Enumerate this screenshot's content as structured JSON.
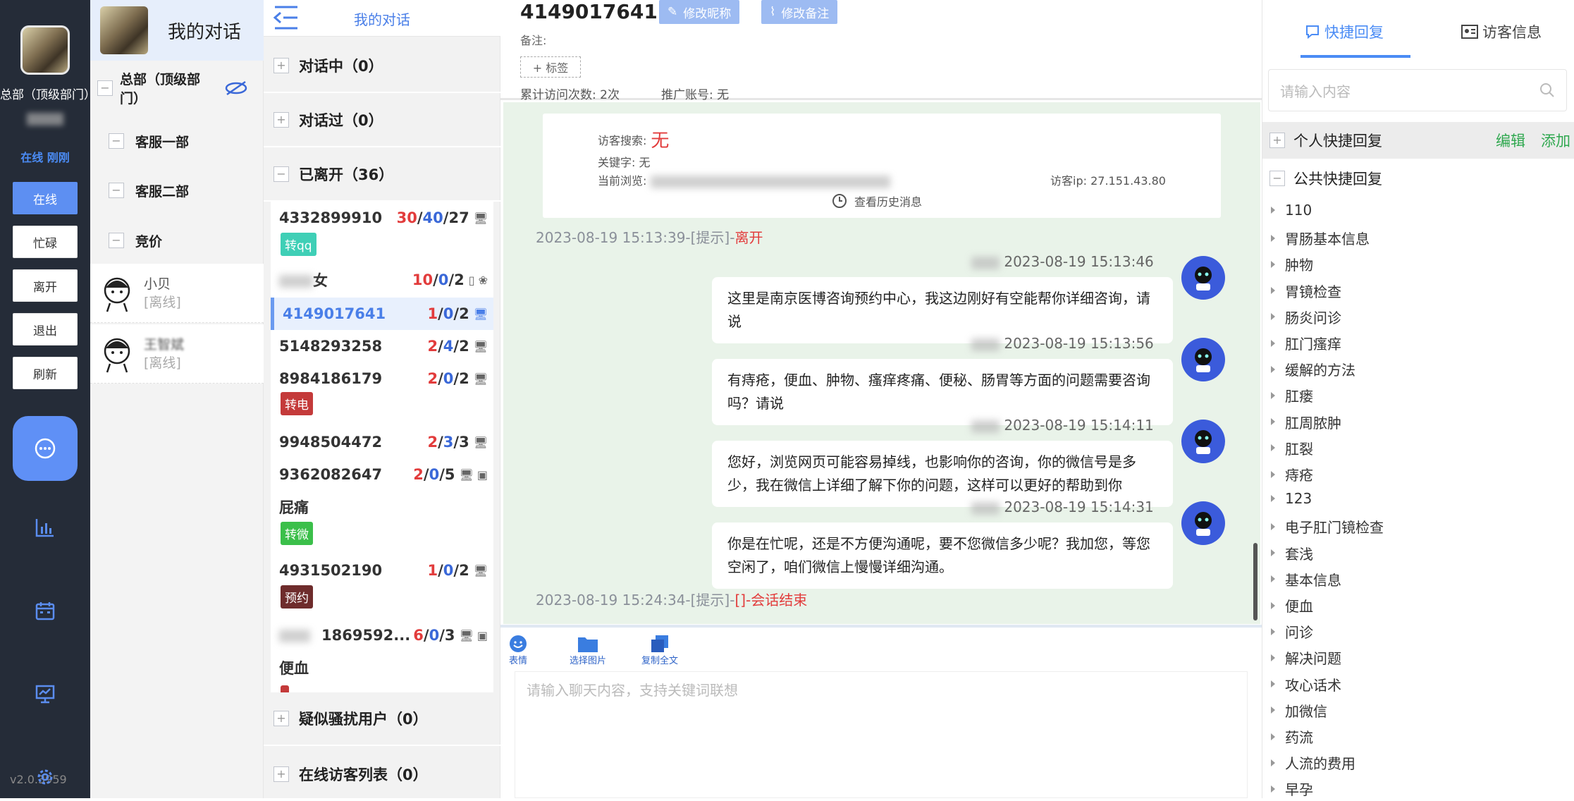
{
  "rail": {
    "dept": "总部（顶级部门）",
    "status": "在线 刚刚",
    "buttons": [
      "在线",
      "忙碌",
      "离开",
      "退出",
      "刷新"
    ],
    "version": "v2.0.3959"
  },
  "col2": {
    "title": "我的对话",
    "tree_root": "总部（顶级部门）",
    "departments": [
      "客服一部",
      "客服二部",
      "竞价"
    ],
    "users": [
      {
        "name": "小贝",
        "status": "[离线]"
      },
      {
        "name": "王智斌",
        "status": "[离线]"
      }
    ]
  },
  "col3": {
    "title": "我的对话",
    "sections": {
      "talking": "对话中（0）",
      "talked": "对话过（0）",
      "left": "已离开（36）",
      "suspect": "疑似骚扰用户（0）",
      "online": "在线访客列表（0）"
    },
    "rows": [
      {
        "id": "4332899910",
        "a": "30",
        "b": "40",
        "c": "27",
        "tag": "转qq"
      },
      {
        "id": "女",
        "a": "10",
        "b": "0",
        "c": "2"
      },
      {
        "id": "4149017641",
        "a": "1",
        "b": "0",
        "c": "2"
      },
      {
        "id": "5148293258",
        "a": "2",
        "b": "4",
        "c": "2"
      },
      {
        "id": "8984186179",
        "a": "2",
        "b": "0",
        "c": "2",
        "tag": "转电"
      },
      {
        "id": "9948504472",
        "a": "2",
        "b": "3",
        "c": "3"
      },
      {
        "id": "9362082647",
        "a": "2",
        "b": "0",
        "c": "5"
      },
      {
        "id": "屁痛",
        "tag": "转微"
      },
      {
        "id": "4931502190",
        "a": "1",
        "b": "0",
        "c": "2",
        "tag": "预约"
      },
      {
        "id": "1869592...",
        "a": "6",
        "b": "0",
        "c": "3"
      },
      {
        "id": "便血"
      }
    ]
  },
  "info": {
    "number": "4149017641",
    "edit_nick": "修改昵称",
    "edit_note": "修改备注",
    "note_label": "备注:",
    "tag_btn": "+ 标签",
    "visits": "累计访问次数: 2次",
    "promo": "推广账号: 无"
  },
  "card": {
    "search_label": "访客搜索:",
    "search_value": "无",
    "keyword": "关键字: 无",
    "browsing": "当前浏览:",
    "ip": "访客ip: 27.151.43.80",
    "history": "查看历史消息"
  },
  "chat": {
    "sys1_time": "2023-08-19 15:13:39-[提示]-",
    "sys1_txt": "离开",
    "messages": [
      {
        "time": "2023-08-19 15:13:46",
        "text": "这里是南京医博咨询预约中心，我这边刚好有空能帮你详细咨询，请说"
      },
      {
        "time": "2023-08-19 15:13:56",
        "text": "有痔疮，便血、肿物、瘙痒疼痛、便秘、肠胃等方面的问题需要咨询吗？请说"
      },
      {
        "time": "2023-08-19 15:14:11",
        "text": "您好，浏览网页可能容易掉线，也影响你的咨询，你的微信号是多少，我在微信上详细了解下你的问题，这样可以更好的帮助到你"
      },
      {
        "time": "2023-08-19 15:14:31",
        "text": "你是在忙呢，还是不方便沟通呢，要不您微信多少呢？我加您，等您空闲了，咱们微信上慢慢详细沟通。"
      }
    ],
    "sys2_time": "2023-08-19 15:24:34-[提示]-",
    "sys2_txt": "[]-会话结束"
  },
  "tools": [
    "表情",
    "选择图片",
    "复制全文"
  ],
  "input_placeholder": "请输入聊天内容，支持关键词联想",
  "right": {
    "tab_quick": "快捷回复",
    "tab_visitor": "访客信息",
    "search_placeholder": "请输入内容",
    "personal": "个人快捷回复",
    "edit": "编辑",
    "add": "添加",
    "public": "公共快捷回复",
    "items": [
      "110",
      "胃肠基本信息",
      "肿物",
      "胃镜检查",
      "肠炎问诊",
      "肛门瘙痒",
      "缓解的方法",
      "肛瘘",
      "肛周脓肿",
      "肛裂",
      "痔疮",
      "123",
      "电子肛门镜检查",
      "套浅",
      "基本信息",
      "便血",
      "问诊",
      "解决问题",
      "攻心话术",
      "加微信",
      "药流",
      "人流的费用",
      "早孕"
    ]
  },
  "colors": {
    "accent": "#4b8cf5",
    "rail": "#252c38",
    "chat_bg": "#e9f3e9",
    "red": "#e23c3c",
    "green": "#2fa84f"
  }
}
